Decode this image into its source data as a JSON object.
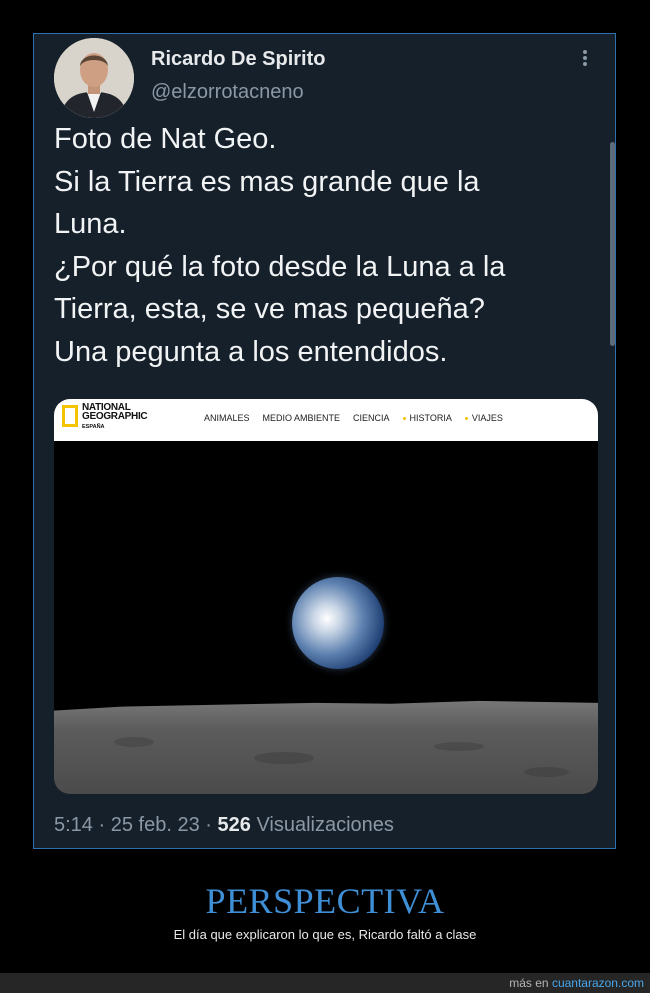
{
  "tweet": {
    "author_name": "Ricardo De Spirito",
    "handle": "@elzorrotacneno",
    "text": "Foto de Nat Geo.\nSi la Tierra es mas grande que la\nLuna.\n¿Por qué la foto desde la Luna a la\nTierra, esta, se ve mas pequeña?\nUna pegunta a los entendidos.",
    "time": "5:14",
    "date": "25 feb. 23",
    "views_count": "526",
    "views_label": "Visualizaciones",
    "separator": "·"
  },
  "media": {
    "brand_title": "NATIONAL\nGEOGRAPHIC",
    "brand_subtitle": "ESPAÑA",
    "nav": [
      "ANIMALES",
      "MEDIO AMBIENTE",
      "CIENCIA",
      "HISTORIA",
      "VIAJES"
    ]
  },
  "caption": {
    "title": "PERSPECTIVA",
    "subtitle": "El día que explicaron lo que es, Ricardo faltó a clase"
  },
  "footer": {
    "prefix": "más en",
    "link": "cuantarazon.com"
  },
  "icons": {
    "more": "more-vertical-icon",
    "logo": "natgeo-logo-icon"
  },
  "colors": {
    "card_background": "#15202b",
    "card_border": "#2f6fae",
    "caption_title": "#3f8fd6",
    "footer_link": "#49a6e9",
    "natgeo_yellow": "#f5c400"
  }
}
